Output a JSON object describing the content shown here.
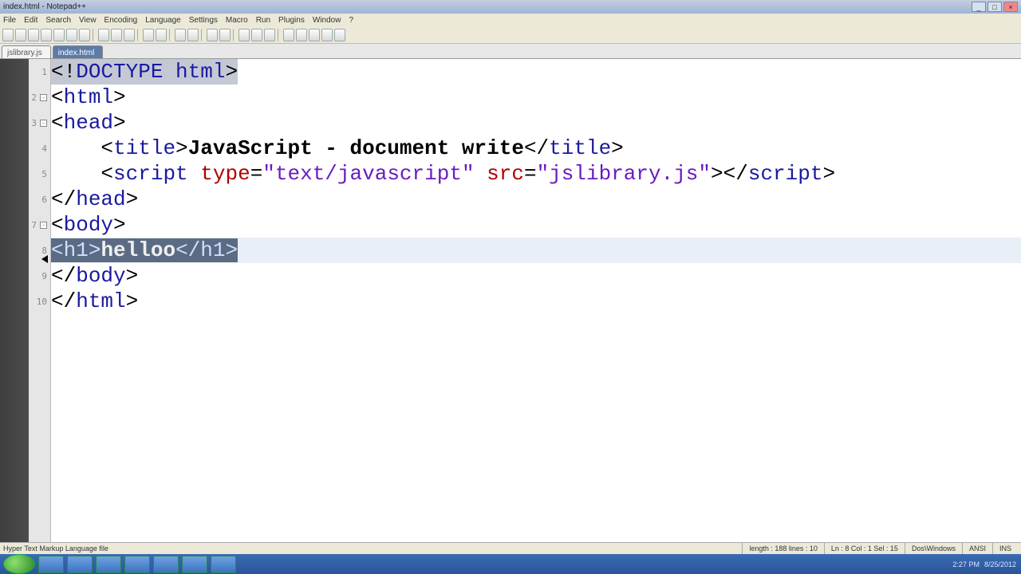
{
  "title": "index.html - Notepad++",
  "menu": {
    "file": "File",
    "edit": "Edit",
    "search": "Search",
    "view": "View",
    "encoding": "Encoding",
    "language": "Language",
    "settings": "Settings",
    "macro": "Macro",
    "run": "Run",
    "plugins": "Plugins",
    "window": "Window",
    "help": "?"
  },
  "tabs": {
    "inactive": "jslibrary.js",
    "active": "index.html"
  },
  "code": {
    "l1": {
      "open": "<!",
      "doctype": "DOCTYPE html",
      "close": ">"
    },
    "l2": {
      "open": "<",
      "tag": "html",
      "close": ">"
    },
    "l3": {
      "open": "<",
      "tag": "head",
      "close": ">"
    },
    "l4": {
      "indent": "    ",
      "open": "<",
      "tag": "title",
      "close": ">",
      "text": "JavaScript - document write",
      "open2": "</",
      "tag2": "title",
      "close2": ">"
    },
    "l5": {
      "indent": "    ",
      "open": "<",
      "tag": "script",
      "sp": " ",
      "attr1": "type",
      "eq1": "=",
      "val1": "\"text/javascript\"",
      "sp2": " ",
      "attr2": "src",
      "eq2": "=",
      "val2": "\"jslibrary.js\"",
      "close": ">",
      "open2": "</",
      "tag2": "script",
      "close2": ">"
    },
    "l6": {
      "open": "</",
      "tag": "head",
      "close": ">"
    },
    "l7": {
      "open": "<",
      "tag": "body",
      "close": ">"
    },
    "l8": {
      "open": "<",
      "tag": "h1",
      "close": ">",
      "text": "helloo",
      "open2": "</",
      "tag2": "h1",
      "close2": ">"
    },
    "l9": {
      "open": "</",
      "tag": "body",
      "close": ">"
    },
    "l10": {
      "open": "</",
      "tag": "html",
      "close": ">"
    }
  },
  "gutter": {
    "n1": "1",
    "n2": "2",
    "n3": "3",
    "n4": "4",
    "n5": "5",
    "n6": "6",
    "n7": "7",
    "n8": "8",
    "n9": "9",
    "n10": "10"
  },
  "status": {
    "lang": "Hyper Text Markup Language file",
    "length": "length : 188    lines : 10",
    "pos": "Ln : 8    Col : 1    Sel : 15",
    "eol": "Dos\\Windows",
    "enc": "ANSI",
    "ovr": "INS"
  },
  "tray": {
    "time": "2:27 PM",
    "date": "8/25/2012"
  }
}
